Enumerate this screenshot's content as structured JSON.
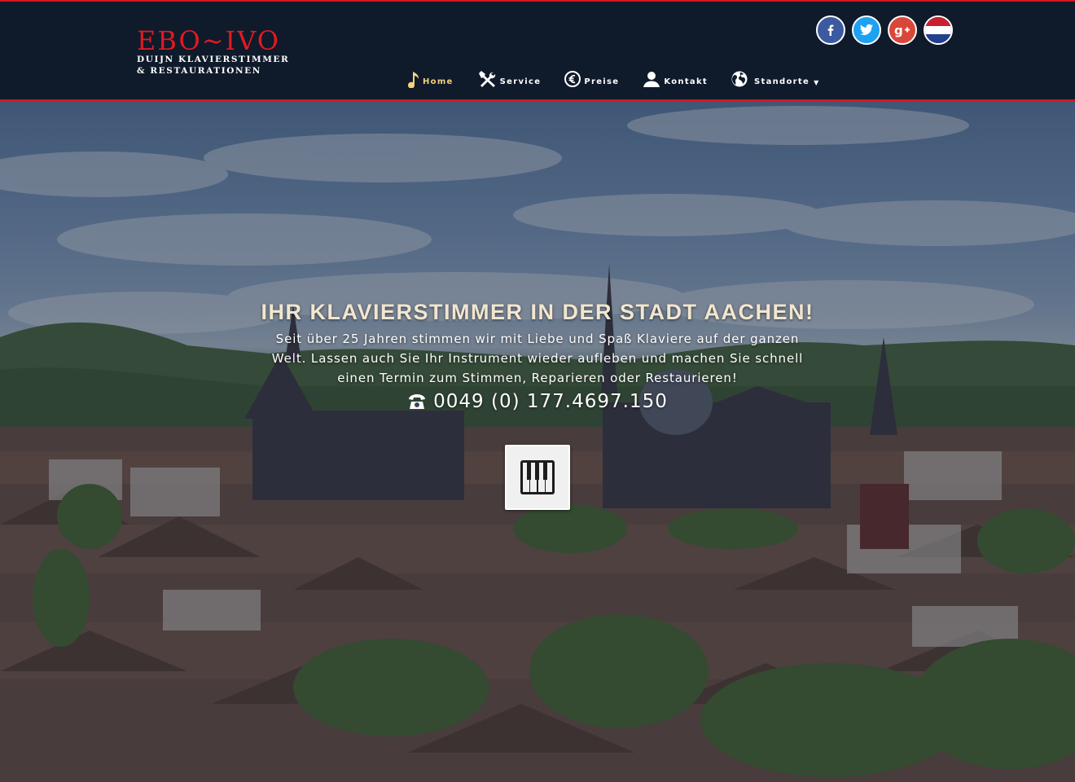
{
  "logo": {
    "main": "EBO~IVO",
    "sub_line1": "DUIJN KLAVIERSTIMMER",
    "sub_line2": "& RESTAURATIONEN"
  },
  "social": [
    {
      "name": "facebook",
      "icon": "facebook-icon"
    },
    {
      "name": "twitter",
      "icon": "twitter-icon"
    },
    {
      "name": "google-plus",
      "icon": "google-plus-icon"
    },
    {
      "name": "language-nl",
      "icon": "netherlands-flag-icon"
    }
  ],
  "nav": {
    "items": [
      {
        "label": "Home",
        "icon": "music-note-icon",
        "active": true
      },
      {
        "label": "Service",
        "icon": "tools-icon"
      },
      {
        "label": "Preise",
        "icon": "euro-icon"
      },
      {
        "label": "Kontakt",
        "icon": "user-icon"
      },
      {
        "label": "Standorte",
        "icon": "globe-icon",
        "dropdown": true
      }
    ]
  },
  "hero": {
    "headline": "IHR KLAVIERSTIMMER IN DER STADT AACHEN!",
    "intro": "Seit über 25 Jahren stimmen wir mit Liebe und Spaß Klaviere auf der ganzen Welt. Lassen auch Sie Ihr Instrument wieder aufleben und machen Sie schnell einen Termin zum Stimmen, Reparieren oder Restaurieren!",
    "phone": "0049 (0) 177.4697.150",
    "phone_icon": "telephone-icon",
    "cta_icon": "piano-keys-icon"
  },
  "colors": {
    "header_bg": "#0f1a2a",
    "accent_red": "#e01a22",
    "nav_active": "#f4d27a"
  }
}
